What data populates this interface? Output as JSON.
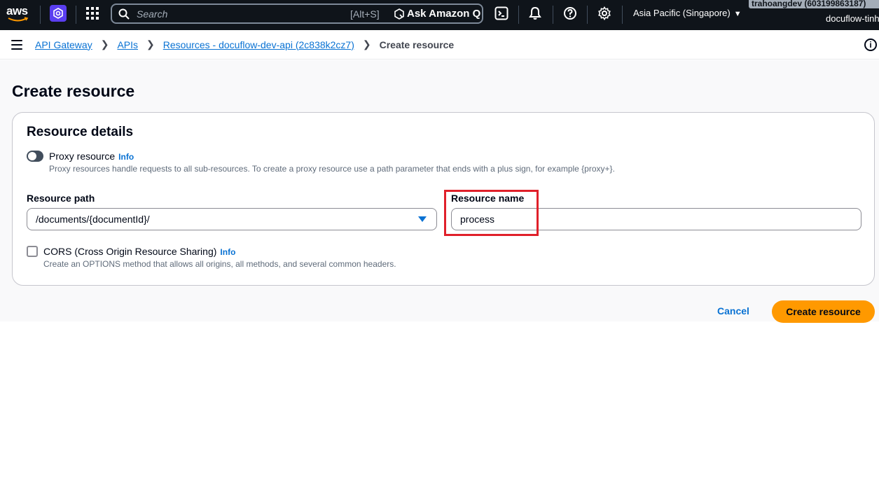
{
  "topnav": {
    "logo_text": "aws",
    "search_placeholder": "Search",
    "search_shortcut": "[Alt+S]",
    "ask_q_label": "Ask Amazon Q",
    "region_label": "Asia Pacific (Singapore)",
    "account_label": "trahoangdev (603199863187)",
    "account_sub": "docuflow-tinh",
    "service_color": "#5a3ef0"
  },
  "breadcrumb": {
    "items": [
      "API Gateway",
      "APIs",
      "Resources - docuflow-dev-api (2c838k2cz7)"
    ],
    "current": "Create resource"
  },
  "page": {
    "title": "Create resource"
  },
  "resource_details": {
    "title": "Resource details",
    "proxy_label": "Proxy resource",
    "proxy_info": "Info",
    "proxy_description": "Proxy resources handle requests to all sub-resources. To create a proxy resource use a path parameter that ends with a plus sign, for example {proxy+}.",
    "proxy_enabled": false,
    "path_label": "Resource path",
    "path_value": "/documents/{documentId}/",
    "name_label": "Resource name",
    "name_value": "process",
    "cors_label": "CORS (Cross Origin Resource Sharing)",
    "cors_info": "Info",
    "cors_description": "Create an OPTIONS method that allows all origins, all methods, and several common headers.",
    "cors_checked": false
  },
  "actions": {
    "cancel_label": "Cancel",
    "submit_label": "Create resource",
    "submit_color": "#ff9900"
  },
  "colors": {
    "nav_bg": "#0f141a",
    "link": "#0972d3",
    "highlight": "#e0202a"
  }
}
